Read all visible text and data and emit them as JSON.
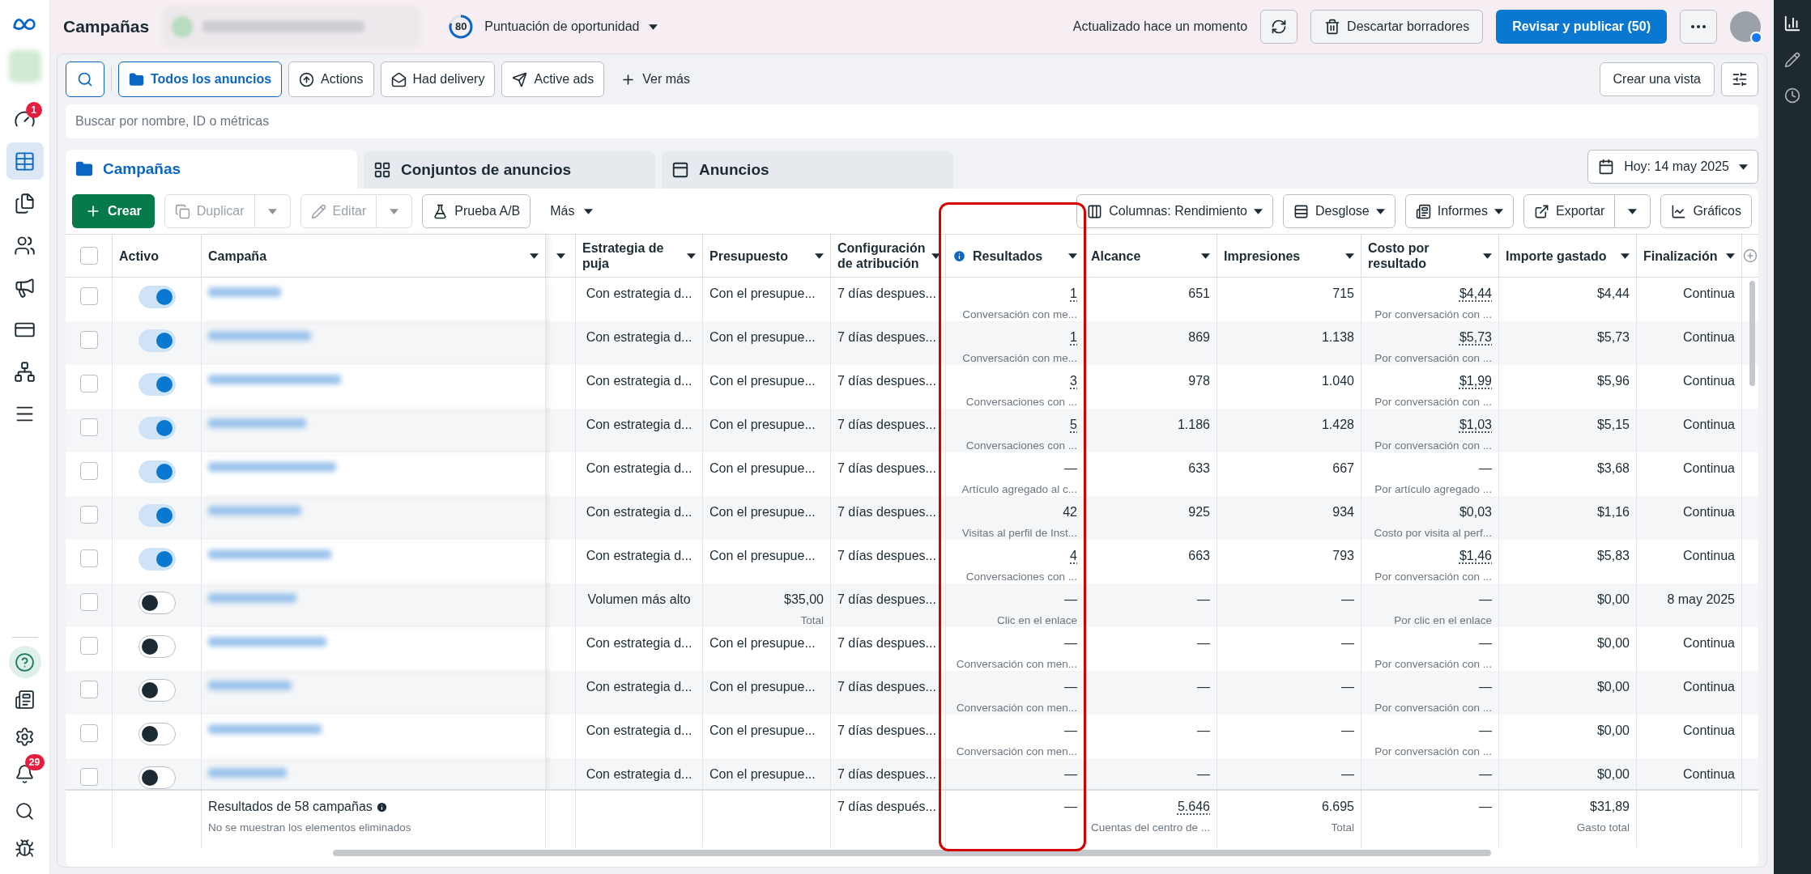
{
  "top_bar": {
    "title": "Campañas",
    "score": {
      "value": "80",
      "label": "Puntuación de oportunidad"
    },
    "status": "Actualizado hace un momento",
    "discard": "Descartar borradores",
    "publish": "Revisar y publicar (50)"
  },
  "sidebar": {
    "top_items": [
      {
        "selected": false,
        "badge": "1"
      },
      {
        "selected": true
      },
      {
        "selected": false
      },
      {
        "selected": false
      },
      {
        "selected": false
      },
      {
        "selected": false
      },
      {
        "selected": false
      },
      {
        "selected": false
      }
    ],
    "bottom_items": [
      {
        "selected": true
      },
      {
        "selected": false
      },
      {
        "selected": false
      },
      {
        "selected": false,
        "badge": "29"
      },
      {
        "selected": false
      },
      {
        "selected": false
      }
    ]
  },
  "filters": [
    {
      "label": "Todos los anuncios",
      "selected": true
    },
    {
      "label": "Actions",
      "selected": false
    },
    {
      "label": "Had delivery",
      "selected": false
    },
    {
      "label": "Active ads",
      "selected": false
    }
  ],
  "more_filters": "Ver más",
  "create_view": "Crear una vista",
  "search": {
    "placeholder": "Buscar por nombre, ID o métricas"
  },
  "tabs": [
    {
      "label": "Campañas",
      "selected": true
    },
    {
      "label": "Conjuntos de anuncios",
      "selected": false
    },
    {
      "label": "Anuncios",
      "selected": false
    }
  ],
  "date": "Hoy: 14 may 2025",
  "toolbar": {
    "create": "Crear",
    "actions": [
      {
        "label": "Duplicar",
        "disabled": true,
        "split": true
      },
      {
        "label": "Editar",
        "disabled": true,
        "split": true
      },
      {
        "label": "Prueba A/B",
        "disabled": false,
        "split": false
      }
    ],
    "more": "Más",
    "right": [
      {
        "label": "Columnas: Rendimiento",
        "split": false
      },
      {
        "label": "Desglose",
        "split": false
      },
      {
        "label": "Informes",
        "split": false
      },
      {
        "label": "Exportar",
        "split": true
      },
      {
        "label": "Gráficos",
        "split": false
      }
    ]
  },
  "table": {
    "select_all": {
      "checked": false
    },
    "columns": [
      {
        "label": "Activo",
        "menu": false,
        "info": false
      },
      {
        "label": "Campaña",
        "menu": true,
        "info": false
      },
      {
        "label": "Estrategia de puja",
        "menu": true,
        "info": false
      },
      {
        "label": "Presupuesto",
        "menu": true,
        "info": false
      },
      {
        "label": "Configuración de atribución",
        "menu": true,
        "info": false
      },
      {
        "label": "Resultados",
        "menu": true,
        "info": true
      },
      {
        "label": "Alcance",
        "menu": true,
        "info": false
      },
      {
        "label": "Impresiones",
        "menu": true,
        "info": false
      },
      {
        "label": "Costo por resultado",
        "menu": true,
        "info": false
      },
      {
        "label": "Importe gastado",
        "menu": true,
        "info": false
      },
      {
        "label": "Finalización",
        "menu": true,
        "info": false
      }
    ],
    "rows": [
      {
        "checked": false,
        "active": true,
        "bid_strategy": "Con estrategia d...",
        "budget": {
          "value": "Con el presupue..."
        },
        "attribution": "7 días despues...",
        "results": {
          "value": "1",
          "sub": "Conversación con me...",
          "dotted": true
        },
        "reach": "651",
        "impressions": "715",
        "cost": {
          "value": "$4,44",
          "sub": "Por conversación con ...",
          "dotted": true
        },
        "spent": "$4,44",
        "end": "Continua"
      },
      {
        "checked": false,
        "active": true,
        "bid_strategy": "Con estrategia d...",
        "budget": {
          "value": "Con el presupue..."
        },
        "attribution": "7 días despues...",
        "results": {
          "value": "1",
          "sub": "Conversación con me...",
          "dotted": true
        },
        "reach": "869",
        "impressions": "1.138",
        "cost": {
          "value": "$5,73",
          "sub": "Por conversación con ...",
          "dotted": true
        },
        "spent": "$5,73",
        "end": "Continua"
      },
      {
        "checked": false,
        "active": true,
        "bid_strategy": "Con estrategia d...",
        "budget": {
          "value": "Con el presupue..."
        },
        "attribution": "7 días despues...",
        "results": {
          "value": "3",
          "sub": "Conversaciones con ...",
          "dotted": true
        },
        "reach": "978",
        "impressions": "1.040",
        "cost": {
          "value": "$1,99",
          "sub": "Por conversación con ...",
          "dotted": true
        },
        "spent": "$5,96",
        "end": "Continua"
      },
      {
        "checked": false,
        "active": true,
        "bid_strategy": "Con estrategia d...",
        "budget": {
          "value": "Con el presupue..."
        },
        "attribution": "7 días despues...",
        "results": {
          "value": "5",
          "sub": "Conversaciones con ...",
          "dotted": true
        },
        "reach": "1.186",
        "impressions": "1.428",
        "cost": {
          "value": "$1,03",
          "sub": "Por conversación con ...",
          "dotted": true
        },
        "spent": "$5,15",
        "end": "Continua"
      },
      {
        "checked": false,
        "active": true,
        "bid_strategy": "Con estrategia d...",
        "budget": {
          "value": "Con el presupue..."
        },
        "attribution": "7 días despues...",
        "results": {
          "value": "—",
          "sub": "Artículo agregado al c...",
          "dotted": false
        },
        "reach": "633",
        "impressions": "667",
        "cost": {
          "value": "—",
          "sub": "Por artículo agregado ...",
          "dotted": false
        },
        "spent": "$3,68",
        "end": "Continua"
      },
      {
        "checked": false,
        "active": true,
        "bid_strategy": "Con estrategia d...",
        "budget": {
          "value": "Con el presupue..."
        },
        "attribution": "7 días despues...",
        "results": {
          "value": "42",
          "sub": "Visitas al perfil de Inst...",
          "dotted": false
        },
        "reach": "925",
        "impressions": "934",
        "cost": {
          "value": "$0,03",
          "sub": "Costo por visita al perf...",
          "dotted": false
        },
        "spent": "$1,16",
        "end": "Continua"
      },
      {
        "checked": false,
        "active": true,
        "bid_strategy": "Con estrategia d...",
        "budget": {
          "value": "Con el presupue..."
        },
        "attribution": "7 días despues...",
        "results": {
          "value": "4",
          "sub": "Conversaciones con ...",
          "dotted": true
        },
        "reach": "663",
        "impressions": "793",
        "cost": {
          "value": "$1,46",
          "sub": "Por conversación con ...",
          "dotted": true
        },
        "spent": "$5,83",
        "end": "Continua"
      },
      {
        "checked": false,
        "active": false,
        "bid_strategy": "Volumen más alto",
        "budget": {
          "value": "$35,00",
          "sub": "Total"
        },
        "attribution": "7 días despues...",
        "results": {
          "value": "—",
          "sub": "Clic en el enlace",
          "dotted": false
        },
        "reach": "—",
        "impressions": "—",
        "cost": {
          "value": "—",
          "sub": "Por clic en el enlace",
          "dotted": false
        },
        "spent": "$0,00",
        "end": "8 may 2025"
      },
      {
        "checked": false,
        "active": false,
        "bid_strategy": "Con estrategia d...",
        "budget": {
          "value": "Con el presupue..."
        },
        "attribution": "7 días despues...",
        "results": {
          "value": "—",
          "sub": "Conversación con men...",
          "dotted": false
        },
        "reach": "—",
        "impressions": "—",
        "cost": {
          "value": "—",
          "sub": "Por conversación con ...",
          "dotted": false
        },
        "spent": "$0,00",
        "end": "Continua"
      },
      {
        "checked": false,
        "active": false,
        "bid_strategy": "Con estrategia d...",
        "budget": {
          "value": "Con el presupue..."
        },
        "attribution": "7 días despues...",
        "results": {
          "value": "—",
          "sub": "Conversación con men...",
          "dotted": false
        },
        "reach": "—",
        "impressions": "—",
        "cost": {
          "value": "—",
          "sub": "Por conversación con ...",
          "dotted": false
        },
        "spent": "$0,00",
        "end": "Continua"
      },
      {
        "checked": false,
        "active": false,
        "bid_strategy": "Con estrategia d...",
        "budget": {
          "value": "Con el presupue..."
        },
        "attribution": "7 días despues...",
        "results": {
          "value": "—",
          "sub": "Conversación con men...",
          "dotted": false
        },
        "reach": "—",
        "impressions": "—",
        "cost": {
          "value": "—",
          "sub": "Por conversación con ...",
          "dotted": false
        },
        "spent": "$0,00",
        "end": "Continua"
      },
      {
        "checked": false,
        "active": false,
        "bid_strategy": "Con estrategia d...",
        "budget": {
          "value": "Con el presupue..."
        },
        "attribution": "7 días despues...",
        "results": {
          "value": "—",
          "dotted": false
        },
        "reach": "—",
        "impressions": "—",
        "cost": {
          "value": "—",
          "dotted": false
        },
        "spent": "$0,00",
        "end": "Continua"
      }
    ],
    "footer": {
      "label": "Resultados de 58 campañas",
      "note": "No se muestran los elementos eliminados",
      "attribution": "7 días después...",
      "results": {
        "value": "—"
      },
      "reach": {
        "value": "5.646",
        "sub": "Cuentas del centro de ...",
        "dotted": true
      },
      "impressions": {
        "value": "6.695",
        "sub": "Total"
      },
      "cost": {
        "value": "—"
      },
      "spent": {
        "value": "$31,89",
        "sub": "Gasto total"
      }
    }
  }
}
